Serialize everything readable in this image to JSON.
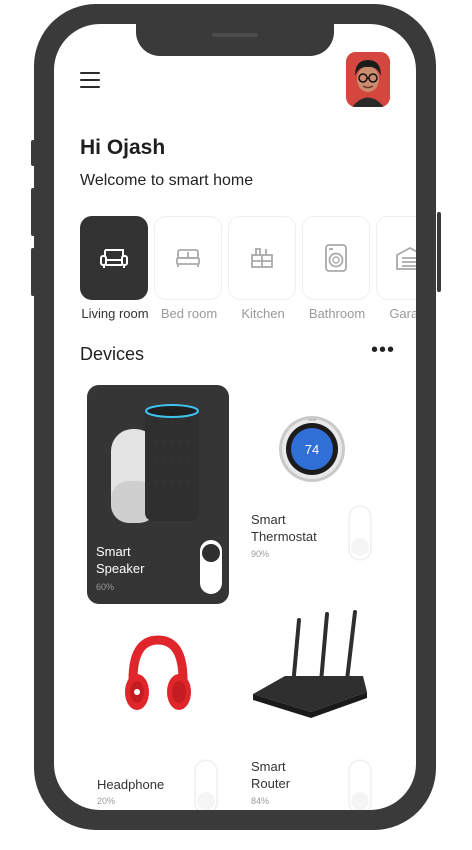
{
  "header": {
    "menu_icon": "hamburger-menu-icon",
    "avatar_icon": "user-avatar"
  },
  "greeting": {
    "title": "Hi Ojash",
    "subtitle": "Welcome to smart home"
  },
  "rooms": [
    {
      "label": "Living room",
      "icon": "sofa-icon",
      "active": true
    },
    {
      "label": "Bed room",
      "icon": "bed-icon",
      "active": false
    },
    {
      "label": "Kitchen",
      "icon": "kitchen-icon",
      "active": false
    },
    {
      "label": "Bathroom",
      "icon": "washing-machine-icon",
      "active": false
    },
    {
      "label": "Garage",
      "icon": "garage-icon",
      "active": false
    }
  ],
  "devices_section": {
    "title": "Devices",
    "more_label": "•••"
  },
  "devices": [
    {
      "name_line1": "Smart",
      "name_line2": "Speaker",
      "percent": "60%",
      "on": true
    },
    {
      "name_line1": "Smart",
      "name_line2": "Thermostat",
      "percent": "90%",
      "on": false,
      "display": "74"
    },
    {
      "name_line1": "Headphone",
      "name_line2": "",
      "percent": "20%",
      "on": false
    },
    {
      "name_line1": "Smart",
      "name_line2": "Router",
      "percent": "84%",
      "on": false
    }
  ],
  "colors": {
    "frame": "#3a3a3a",
    "active_tile": "#333333",
    "thermostat_blue": "#2f6fd6",
    "headphone_red": "#e0262b"
  }
}
